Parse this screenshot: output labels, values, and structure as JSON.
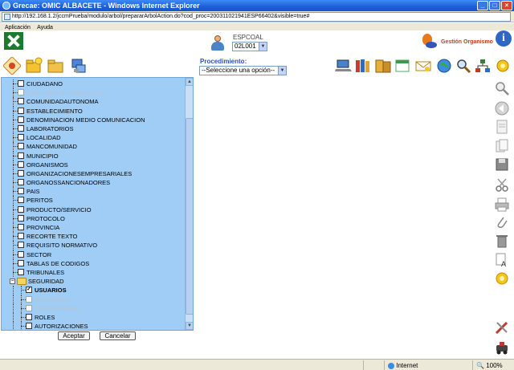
{
  "window": {
    "title": "Grecae: OMIC ALBACETE - Windows Internet Explorer",
    "url": "http://192.168.1.2/jccmPrueba/modulo/arbol/prepararArbolAction.do?cod_proc=200311021941ESP66402&visible=true#"
  },
  "menu": [
    "Aplicación",
    "Ayuda"
  ],
  "header": {
    "user_label": "ESPCOAL",
    "user_select": "02L001",
    "gestion_label": "Gestión Organismo",
    "procedimiento_label": "Procedimiento:",
    "procedimiento_select": "--Seleccione una opción--"
  },
  "tree": {
    "items": [
      {
        "label": "CIUDADANO",
        "state": "partial"
      },
      {
        "label": "COMISION REGIONAL DCC",
        "state": "disabled"
      },
      {
        "label": "COMUNIDADAUTONOMA",
        "state": "unchecked"
      },
      {
        "label": "ESTABLECIMIENTO",
        "state": "unchecked"
      },
      {
        "label": "DENOMINACION MEDIO COMUNICACION",
        "state": "unchecked"
      },
      {
        "label": "LABORATORIOS",
        "state": "unchecked"
      },
      {
        "label": "LOCALIDAD",
        "state": "unchecked"
      },
      {
        "label": "MANCOMUNIDAD",
        "state": "unchecked"
      },
      {
        "label": "MUNICIPIO",
        "state": "unchecked"
      },
      {
        "label": "ORGANISMOS",
        "state": "unchecked"
      },
      {
        "label": "ORGANIZACIONESEMPRESARIALES",
        "state": "unchecked"
      },
      {
        "label": "ORGANOSSANCIONADORES",
        "state": "unchecked"
      },
      {
        "label": "PAIS",
        "state": "unchecked"
      },
      {
        "label": "PERITOS",
        "state": "unchecked"
      },
      {
        "label": "PRODUCTO/SERVICIO",
        "state": "unchecked"
      },
      {
        "label": "PROTOCOLO",
        "state": "unchecked"
      },
      {
        "label": "PROVINCIA",
        "state": "unchecked"
      },
      {
        "label": "RECORTE TEXTO",
        "state": "unchecked"
      },
      {
        "label": "REQUISITO NORMATIVO",
        "state": "unchecked"
      },
      {
        "label": "SECTOR",
        "state": "unchecked"
      },
      {
        "label": "TABLAS DE CODIGOS",
        "state": "unchecked"
      },
      {
        "label": "TRIBUNALES",
        "state": "unchecked"
      }
    ],
    "seguridad_label": "SEGURIDAD",
    "children": [
      {
        "label": "USUARIOS",
        "state": "checked"
      },
      {
        "label": "RECURSOS",
        "state": "disabled"
      },
      {
        "label": "OPERACIONES",
        "state": "disabled"
      },
      {
        "label": "ROLES",
        "state": "unchecked"
      },
      {
        "label": "AUTORIZACIONES",
        "state": "unchecked"
      }
    ],
    "accept_label": "Aceptar",
    "cancel_label": "Cancelar"
  },
  "status": {
    "zone": "Internet",
    "zoom": "100%"
  },
  "colors": {
    "tree_bg": "#9fcdf5",
    "titlebar": "#1d5fd6",
    "proc_label": "#2c50c0"
  }
}
